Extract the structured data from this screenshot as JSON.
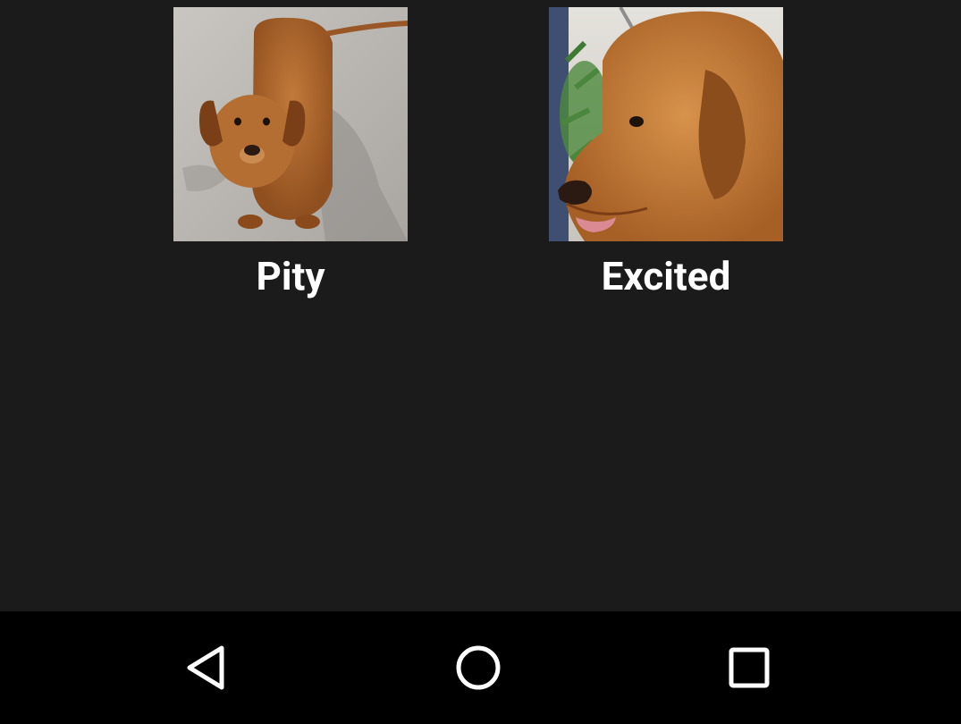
{
  "cards": [
    {
      "label": "Pity",
      "image": "dachshund-photo"
    },
    {
      "label": "Excited",
      "image": "golden-retriever-photo"
    }
  ],
  "navbar": {
    "back_icon": "back-triangle-icon",
    "home_icon": "home-circle-icon",
    "recents_icon": "recents-square-icon"
  },
  "colors": {
    "background": "#1b1b1c",
    "navbar": "#000000",
    "label_text": "#ffffff",
    "nav_icon": "#ffffff"
  }
}
